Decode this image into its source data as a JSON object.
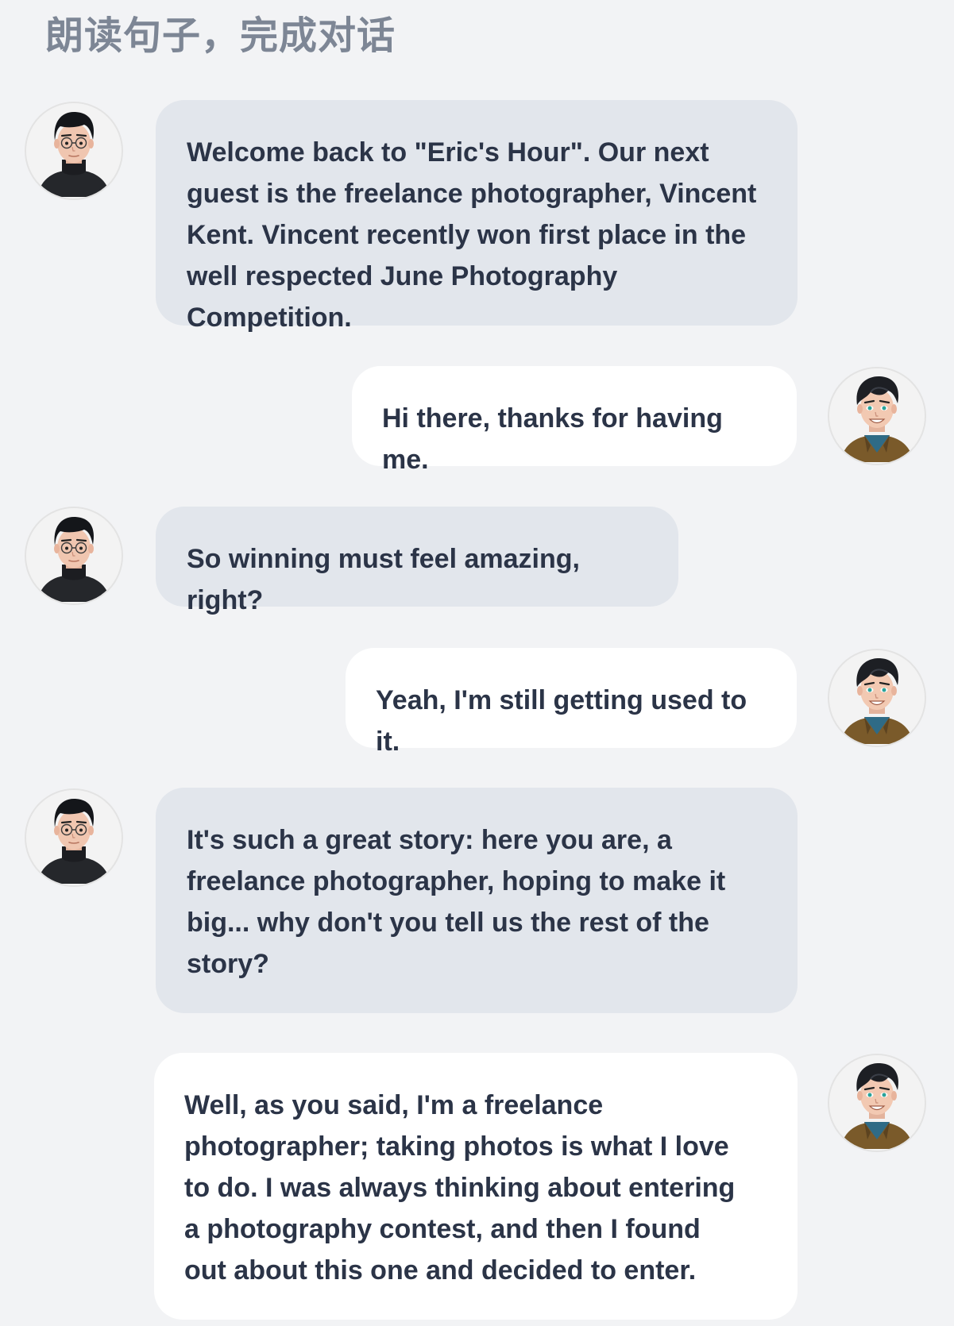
{
  "page": {
    "title": "朗读句子，完成对话"
  },
  "conversation": {
    "messages": [
      {
        "speaker": "host",
        "avatar_icon": "host-avatar-icon",
        "text": "Welcome back to \"Eric's Hour\". Our next guest is the freelance photographer, Vincent Kent. Vincent recently won first place in the well respected June Photography Competition."
      },
      {
        "speaker": "guest",
        "avatar_icon": "guest-avatar-icon",
        "text": "Hi there, thanks for having me."
      },
      {
        "speaker": "host",
        "avatar_icon": "host-avatar-icon",
        "text": "So winning must feel amazing, right?"
      },
      {
        "speaker": "guest",
        "avatar_icon": "guest-avatar-icon",
        "text": "Yeah, I'm still getting used to it."
      },
      {
        "speaker": "host",
        "avatar_icon": "host-avatar-icon",
        "text": "It's such a great story: here you are, a freelance photographer, hoping to make it big... why don't you tell us the rest of the story?"
      },
      {
        "speaker": "guest",
        "avatar_icon": "guest-avatar-icon",
        "text": "Well, as you said, I'm a freelance photographer; taking photos is what I love to do. I was always thinking about entering a photography contest, and then I found out about this one and decided to enter."
      }
    ]
  },
  "colors": {
    "background": "#f2f3f5",
    "host_bubble": "#e2e6ec",
    "guest_bubble": "#ffffff",
    "text": "#2b3447",
    "title": "#7d8695"
  }
}
